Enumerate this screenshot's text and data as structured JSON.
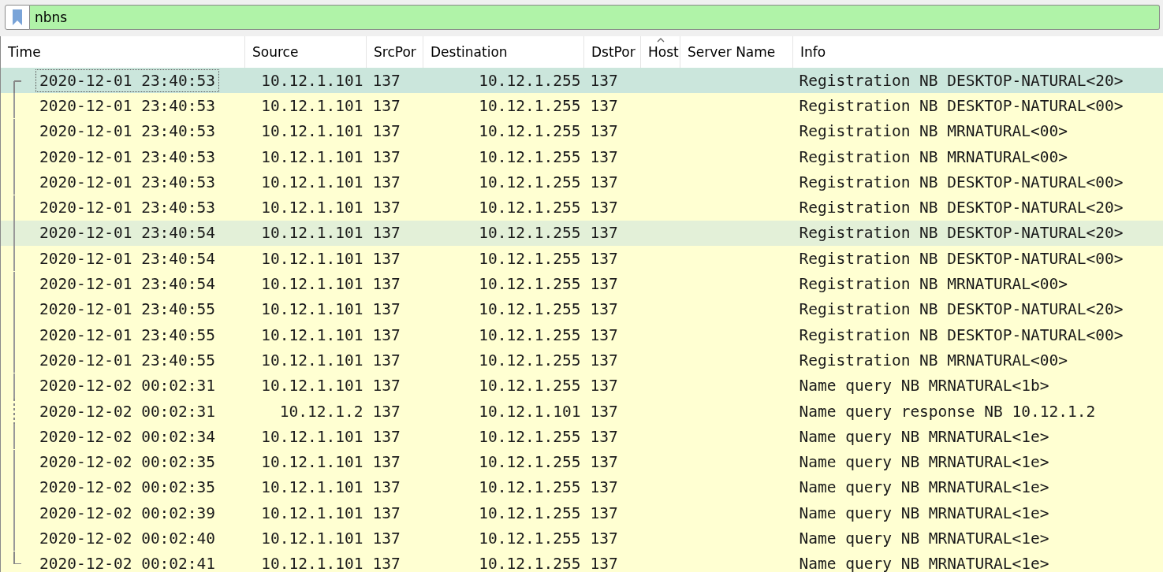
{
  "filter": {
    "value": "nbns"
  },
  "columns": [
    {
      "label": "Time",
      "sorted": false
    },
    {
      "label": "Source",
      "sorted": false
    },
    {
      "label": "SrcPor",
      "sorted": false
    },
    {
      "label": "Destination",
      "sorted": false
    },
    {
      "label": "DstPor",
      "sorted": false
    },
    {
      "label": "Host",
      "sorted": true
    },
    {
      "label": "Server Name",
      "sorted": false
    },
    {
      "label": "Info",
      "sorted": false
    }
  ],
  "rows": [
    {
      "selected": true,
      "hovered": false,
      "kind": "first",
      "time": "2020-12-01 23:40:53",
      "source": "10.12.1.101",
      "srcport": "137",
      "destination": "10.12.1.255",
      "dstport": "137",
      "info": "Registration NB DESKTOP-NATURAL<20>"
    },
    {
      "selected": false,
      "hovered": false,
      "kind": "middle",
      "time": "2020-12-01 23:40:53",
      "source": "10.12.1.101",
      "srcport": "137",
      "destination": "10.12.1.255",
      "dstport": "137",
      "info": "Registration NB DESKTOP-NATURAL<00>"
    },
    {
      "selected": false,
      "hovered": false,
      "kind": "middle",
      "time": "2020-12-01 23:40:53",
      "source": "10.12.1.101",
      "srcport": "137",
      "destination": "10.12.1.255",
      "dstport": "137",
      "info": "Registration NB MRNATURAL<00>"
    },
    {
      "selected": false,
      "hovered": false,
      "kind": "middle",
      "time": "2020-12-01 23:40:53",
      "source": "10.12.1.101",
      "srcport": "137",
      "destination": "10.12.1.255",
      "dstport": "137",
      "info": "Registration NB MRNATURAL<00>"
    },
    {
      "selected": false,
      "hovered": false,
      "kind": "middle",
      "time": "2020-12-01 23:40:53",
      "source": "10.12.1.101",
      "srcport": "137",
      "destination": "10.12.1.255",
      "dstport": "137",
      "info": "Registration NB DESKTOP-NATURAL<00>"
    },
    {
      "selected": false,
      "hovered": false,
      "kind": "middle",
      "time": "2020-12-01 23:40:53",
      "source": "10.12.1.101",
      "srcport": "137",
      "destination": "10.12.1.255",
      "dstport": "137",
      "info": "Registration NB DESKTOP-NATURAL<20>"
    },
    {
      "selected": false,
      "hovered": true,
      "kind": "middle",
      "time": "2020-12-01 23:40:54",
      "source": "10.12.1.101",
      "srcport": "137",
      "destination": "10.12.1.255",
      "dstport": "137",
      "info": "Registration NB DESKTOP-NATURAL<20>"
    },
    {
      "selected": false,
      "hovered": false,
      "kind": "middle",
      "time": "2020-12-01 23:40:54",
      "source": "10.12.1.101",
      "srcport": "137",
      "destination": "10.12.1.255",
      "dstport": "137",
      "info": "Registration NB DESKTOP-NATURAL<00>"
    },
    {
      "selected": false,
      "hovered": false,
      "kind": "middle",
      "time": "2020-12-01 23:40:54",
      "source": "10.12.1.101",
      "srcport": "137",
      "destination": "10.12.1.255",
      "dstport": "137",
      "info": "Registration NB MRNATURAL<00>"
    },
    {
      "selected": false,
      "hovered": false,
      "kind": "middle",
      "time": "2020-12-01 23:40:55",
      "source": "10.12.1.101",
      "srcport": "137",
      "destination": "10.12.1.255",
      "dstport": "137",
      "info": "Registration NB DESKTOP-NATURAL<20>"
    },
    {
      "selected": false,
      "hovered": false,
      "kind": "middle",
      "time": "2020-12-01 23:40:55",
      "source": "10.12.1.101",
      "srcport": "137",
      "destination": "10.12.1.255",
      "dstport": "137",
      "info": "Registration NB DESKTOP-NATURAL<00>"
    },
    {
      "selected": false,
      "hovered": false,
      "kind": "middle",
      "time": "2020-12-01 23:40:55",
      "source": "10.12.1.101",
      "srcport": "137",
      "destination": "10.12.1.255",
      "dstport": "137",
      "info": "Registration NB MRNATURAL<00>"
    },
    {
      "selected": false,
      "hovered": false,
      "kind": "middle",
      "time": "2020-12-02 00:02:31",
      "source": "10.12.1.101",
      "srcport": "137",
      "destination": "10.12.1.255",
      "dstport": "137",
      "info": "Name query NB MRNATURAL<1b>"
    },
    {
      "selected": false,
      "hovered": false,
      "kind": "response",
      "time": "2020-12-02 00:02:31",
      "source": "10.12.1.2",
      "srcport": "137",
      "destination": "10.12.1.101",
      "dstport": "137",
      "info": "Name query response NB 10.12.1.2"
    },
    {
      "selected": false,
      "hovered": false,
      "kind": "middle",
      "time": "2020-12-02 00:02:34",
      "source": "10.12.1.101",
      "srcport": "137",
      "destination": "10.12.1.255",
      "dstport": "137",
      "info": "Name query NB MRNATURAL<1e>"
    },
    {
      "selected": false,
      "hovered": false,
      "kind": "middle",
      "time": "2020-12-02 00:02:35",
      "source": "10.12.1.101",
      "srcport": "137",
      "destination": "10.12.1.255",
      "dstport": "137",
      "info": "Name query NB MRNATURAL<1e>"
    },
    {
      "selected": false,
      "hovered": false,
      "kind": "middle",
      "time": "2020-12-02 00:02:35",
      "source": "10.12.1.101",
      "srcport": "137",
      "destination": "10.12.1.255",
      "dstport": "137",
      "info": "Name query NB MRNATURAL<1e>"
    },
    {
      "selected": false,
      "hovered": false,
      "kind": "middle",
      "time": "2020-12-02 00:02:39",
      "source": "10.12.1.101",
      "srcport": "137",
      "destination": "10.12.1.255",
      "dstport": "137",
      "info": "Name query NB MRNATURAL<1e>"
    },
    {
      "selected": false,
      "hovered": false,
      "kind": "middle",
      "time": "2020-12-02 00:02:40",
      "source": "10.12.1.101",
      "srcport": "137",
      "destination": "10.12.1.255",
      "dstport": "137",
      "info": "Name query NB MRNATURAL<1e>"
    },
    {
      "selected": false,
      "hovered": false,
      "kind": "last",
      "time": "2020-12-02 00:02:41",
      "source": "10.12.1.101",
      "srcport": "137",
      "destination": "10.12.1.255",
      "dstport": "137",
      "info": "Name query NB MRNATURAL<1e>"
    }
  ]
}
